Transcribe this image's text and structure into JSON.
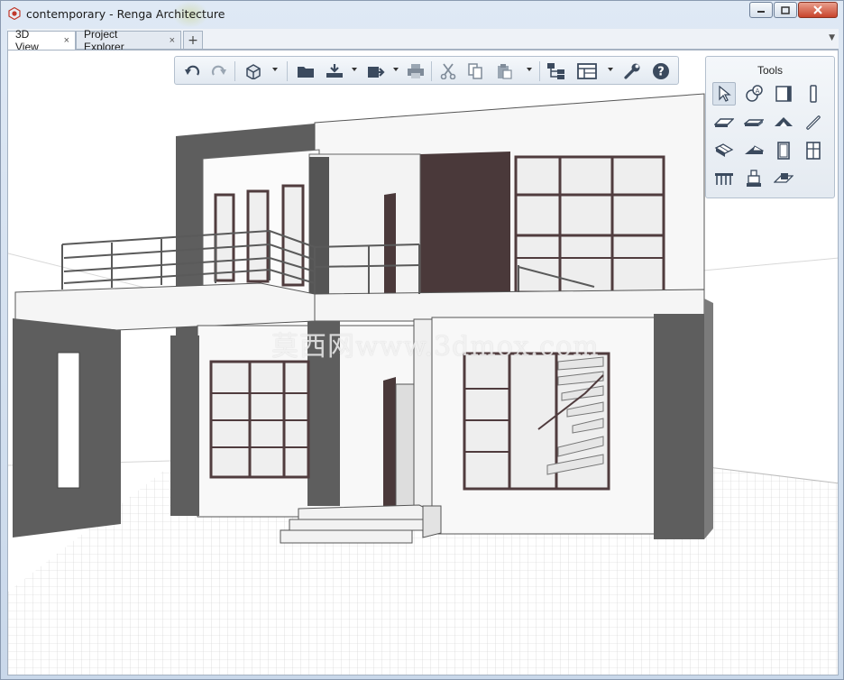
{
  "window": {
    "title": "contemporary - Renga Architecture",
    "app_icon": "renga-logo-icon",
    "controls": [
      "minimize-icon",
      "maximize-icon",
      "close-icon"
    ]
  },
  "tabs": [
    {
      "label": "3D View",
      "active": true
    },
    {
      "label": "Project Explorer",
      "active": false
    }
  ],
  "tab_add_label": "+",
  "tab_close_glyph": "×",
  "toolbar": {
    "items": [
      "undo-icon",
      "redo-icon",
      "view-cube-icon",
      "open-folder-icon",
      "import-icon",
      "export-icon",
      "print-icon",
      "cut-icon",
      "copy-icon",
      "paste-icon",
      "hierarchy-icon",
      "grid-view-icon",
      "wrench-icon",
      "help-icon"
    ]
  },
  "tools_panel": {
    "title": "Tools",
    "tools": [
      "select-icon",
      "annotation-icon",
      "room-icon",
      "column-icon",
      "slab-icon",
      "beam-icon",
      "roof-icon",
      "line-icon",
      "stairs-icon",
      "ramp-icon",
      "door-icon",
      "window-icon",
      "railing-icon",
      "equipment-icon",
      "opening-icon"
    ],
    "selected": "select-icon"
  },
  "viewport": {
    "watermark": "莫西网www.3dmox.com"
  },
  "colors": {
    "accent_wall": "#4a393a",
    "dark_gray": "#5e5e5e",
    "frame_brown": "#503c3e",
    "title_bar": "#c9d8ea",
    "close_button": "#c8442c"
  }
}
